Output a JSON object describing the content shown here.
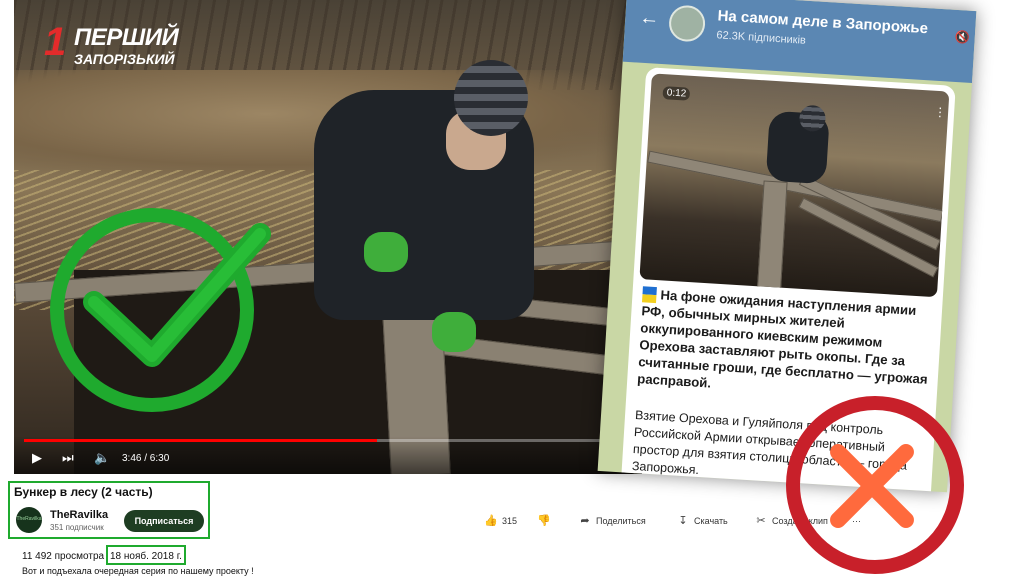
{
  "channel_logo": {
    "number": "1",
    "name": "ПЕРШИЙ",
    "subtitle": "ЗАПОРІЗЬКИЙ"
  },
  "player": {
    "current_time": "3:46",
    "duration": "6:30",
    "time_label": "3:46 / 6:30",
    "progress_fraction": 0.58,
    "icons": [
      "play-icon",
      "next-icon",
      "volume-icon"
    ]
  },
  "video": {
    "title": "Бункер в лесу (2 часть)",
    "channel": "TheRavilka",
    "avatar_text": "TheRavilka",
    "subscribers": "351 подписчик",
    "subscribe_label": "Подписаться",
    "likes": "315",
    "share_label": "Поделиться",
    "download_label": "Скачать",
    "clip_label": "Создать клип",
    "more_label": "···",
    "views": "11 492 просмотра",
    "date": "18 нояб. 2018 г.",
    "description": "Вот и подъехала  очередная серия по нашему проекту !"
  },
  "telegram": {
    "channel_title": "На самом деле в Запорожье",
    "subscribers": "62.3K підписників",
    "video_time": "0:12",
    "post_text": "На фоне ожидания наступления армии РФ, обычных мирных жителей оккупированного киевским режимом Орехова заставляют рыть окопы. Где за считанные гроши, где бесплатно — угрожая расправой.",
    "post_text_2": "Взятие Орехова и Гуляйполя под контроль Российской Армии открывает оперативный простор для взятия столицы области — города Запорожья."
  },
  "colors": {
    "check_green": "#1faa2e",
    "cross_red": "#c8202a",
    "cross_orange": "#ff6a3d",
    "tg_header": "#5b87b3"
  }
}
